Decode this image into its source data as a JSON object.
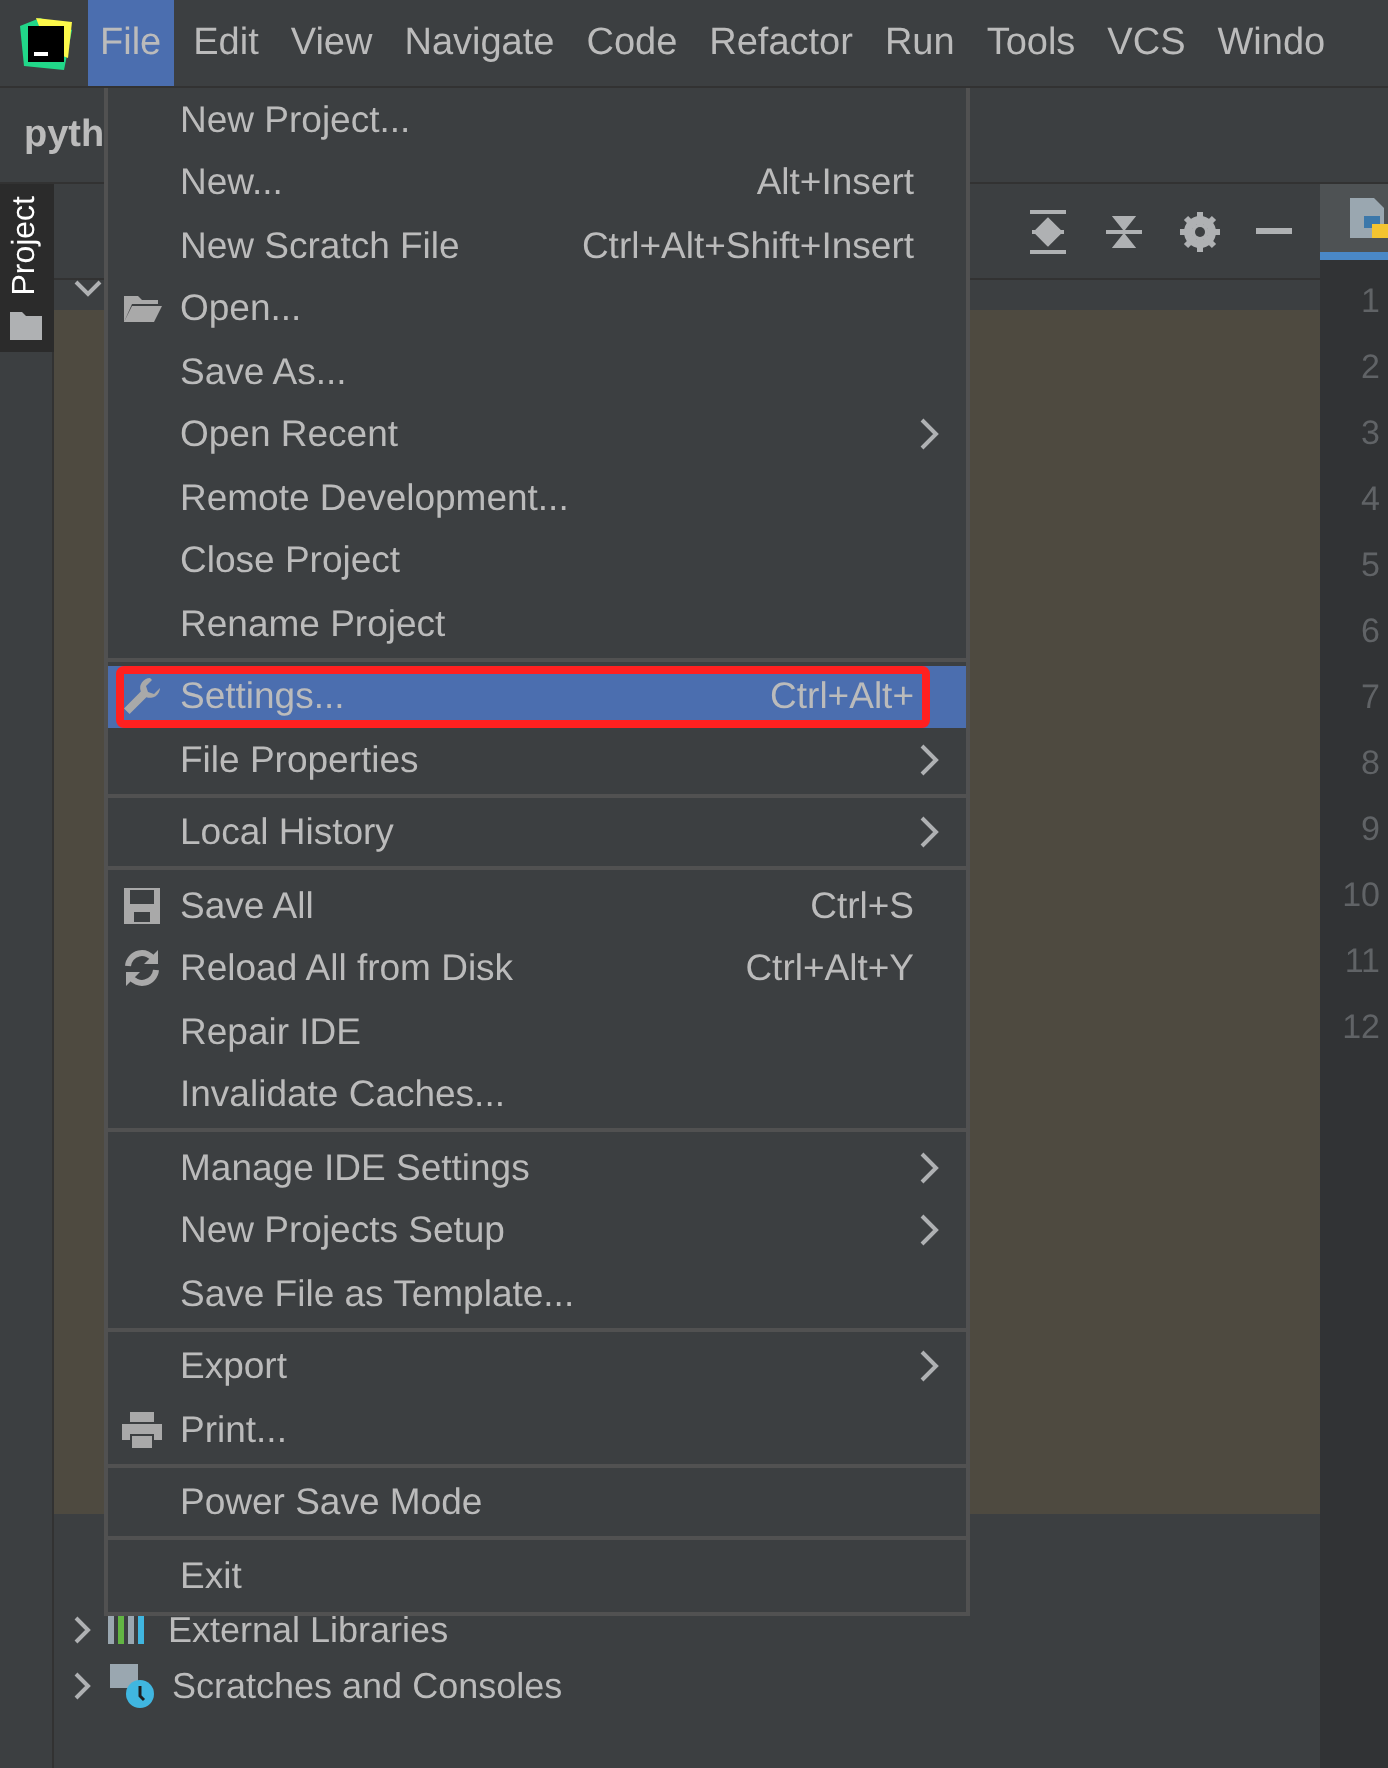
{
  "menubar": {
    "items": [
      {
        "label": "File",
        "selected": true
      },
      {
        "label": "Edit",
        "selected": false
      },
      {
        "label": "View",
        "selected": false
      },
      {
        "label": "Navigate",
        "selected": false
      },
      {
        "label": "Code",
        "selected": false
      },
      {
        "label": "Refactor",
        "selected": false
      },
      {
        "label": "Run",
        "selected": false
      },
      {
        "label": "Tools",
        "selected": false
      },
      {
        "label": "VCS",
        "selected": false
      },
      {
        "label": "Windo",
        "selected": false
      }
    ]
  },
  "navbar": {
    "project": "pyth"
  },
  "tool_stripe": {
    "label": "Project"
  },
  "project_tree": {
    "rows": [
      {
        "label": "External Libraries"
      },
      {
        "label": "Scratches and Consoles"
      }
    ]
  },
  "editor": {
    "line_numbers": [
      "1",
      "2",
      "3",
      "4",
      "5",
      "6",
      "7",
      "8",
      "9",
      "10",
      "11",
      "12"
    ]
  },
  "file_menu": {
    "items": [
      {
        "kind": "plain",
        "label": "New Project...",
        "submenu": false,
        "selected": false
      },
      {
        "kind": "plain",
        "label": "New...",
        "shortcut": "Alt+Insert",
        "submenu": false,
        "selected": false
      },
      {
        "kind": "plain",
        "label": "New Scratch File",
        "shortcut": "Ctrl+Alt+Shift+Insert",
        "submenu": false,
        "selected": false
      },
      {
        "kind": "folder",
        "label": "Open...",
        "submenu": false,
        "selected": false
      },
      {
        "kind": "plain",
        "label": "Save As...",
        "submenu": false,
        "selected": false
      },
      {
        "kind": "plain",
        "label": "Open Recent",
        "submenu": true,
        "selected": false
      },
      {
        "kind": "plain",
        "label": "Remote Development...",
        "submenu": false,
        "selected": false
      },
      {
        "kind": "plain",
        "label": "Close Project",
        "submenu": false,
        "selected": false
      },
      {
        "kind": "plain",
        "label": "Rename Project",
        "submenu": false,
        "selected": false
      },
      {
        "kind": "separator"
      },
      {
        "kind": "wrench",
        "label": "Settings...",
        "shortcut": "Ctrl+Alt+",
        "submenu": false,
        "selected": true,
        "annotated": true
      },
      {
        "kind": "plain",
        "label": "File Properties",
        "submenu": true,
        "selected": false
      },
      {
        "kind": "separator"
      },
      {
        "kind": "plain",
        "label": "Local History",
        "submenu": true,
        "selected": false
      },
      {
        "kind": "separator"
      },
      {
        "kind": "disk",
        "label": "Save All",
        "shortcut": "Ctrl+S",
        "submenu": false,
        "selected": false
      },
      {
        "kind": "reload",
        "label": "Reload All from Disk",
        "shortcut": "Ctrl+Alt+Y",
        "submenu": false,
        "selected": false
      },
      {
        "kind": "plain",
        "label": "Repair IDE",
        "submenu": false,
        "selected": false
      },
      {
        "kind": "plain",
        "label": "Invalidate Caches...",
        "submenu": false,
        "selected": false
      },
      {
        "kind": "separator"
      },
      {
        "kind": "plain",
        "label": "Manage IDE Settings",
        "submenu": true,
        "selected": false
      },
      {
        "kind": "plain",
        "label": "New Projects Setup",
        "submenu": true,
        "selected": false
      },
      {
        "kind": "plain",
        "label": "Save File as Template...",
        "submenu": false,
        "selected": false
      },
      {
        "kind": "separator"
      },
      {
        "kind": "plain",
        "label": "Export",
        "submenu": true,
        "selected": false
      },
      {
        "kind": "printer",
        "label": "Print...",
        "submenu": false,
        "selected": false
      },
      {
        "kind": "separator"
      },
      {
        "kind": "plain",
        "label": "Power Save Mode",
        "submenu": false,
        "selected": false
      },
      {
        "kind": "separator"
      },
      {
        "kind": "plain",
        "label": "Exit",
        "submenu": false,
        "selected": false
      }
    ]
  }
}
